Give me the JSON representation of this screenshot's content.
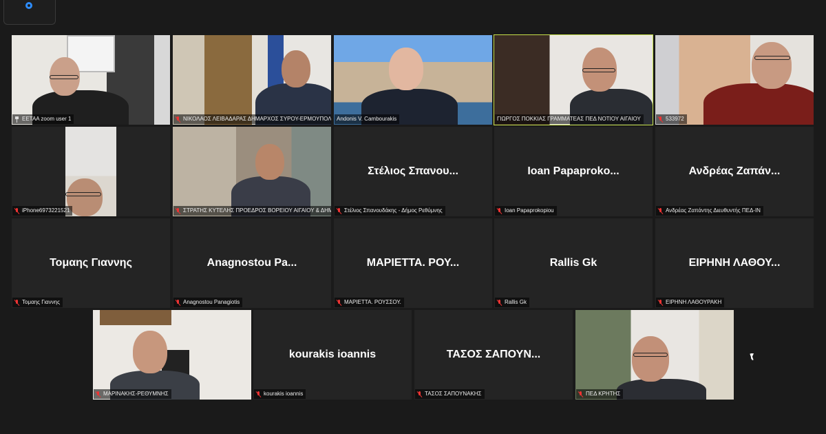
{
  "app": {
    "colors": {
      "background": "#1a1a1a",
      "tile": "#242424",
      "active_border": "#c7e24a",
      "muted_mic": "#e33333",
      "accent": "#2d8cff"
    }
  },
  "participants": [
    {
      "name": "ΕΕΤΑΑ zoom user 1",
      "video": true,
      "mic": "pin"
    },
    {
      "name": "ΝΙΚΟΛΑΟΣ ΛΕΙΒΑΔΑΡΑΣ ΔΗΜΑΡΧΟΣ ΣΥΡΟΥ-ΕΡΜΟΥΠΟΛ...",
      "video": true,
      "mic": "muted"
    },
    {
      "name": "Andonis V. Cambourakis",
      "video": true,
      "mic": "none"
    },
    {
      "name": "ΓΙΩΡΓΟΣ ΠΟΚΚΙΑΣ ΓΡΑΜΜΑΤΕΑΣ ΠΕΔ ΝΟΤΙΟΥ ΑΙΓΑΙΟΥ",
      "video": true,
      "mic": "none",
      "active": true
    },
    {
      "name": "533972",
      "video": true,
      "mic": "muted"
    },
    {
      "name": "iPhone6973221521",
      "video": true,
      "mic": "muted"
    },
    {
      "name": "ΣΤΡΑΤΗΣ ΚΥΤΕΛΗΣ ΠΡΟΕΔΡΟΣ ΒΟΡΕΙΟΥ ΑΙΓΑΙΟΥ & ΔΗΜ...",
      "video": true,
      "mic": "muted"
    },
    {
      "name": "Στέλιος Σπανουδάκης - Δήμος Ρεθύμνης",
      "display": "Στέλιος Σπανου...",
      "video": false,
      "mic": "muted"
    },
    {
      "name": "Ioan Papaprokopiou",
      "display": "Ioan  Papaproko...",
      "video": false,
      "mic": "muted"
    },
    {
      "name": "Ανδρέας Ζαπάντης Διευθυντής ΠΕΔ-ΙΝ",
      "display": "Ανδρέας Ζαπάν...",
      "video": false,
      "mic": "muted"
    },
    {
      "name": "Τομαης Γιαννης",
      "display": "Τομαης Γιαννης",
      "video": false,
      "mic": "muted"
    },
    {
      "name": "Anagnostou Panagiotis",
      "display": "Anagnostou  Pa...",
      "video": false,
      "mic": "muted"
    },
    {
      "name": "ΜΑΡΙΕΤΤΑ. ΡΟΥΣΣΟΥ.",
      "display": "ΜΑΡΙΕΤΤΑ.  ΡΟΥ...",
      "video": false,
      "mic": "muted"
    },
    {
      "name": "Rallis Gk",
      "display": "Rallis Gk",
      "video": false,
      "mic": "muted"
    },
    {
      "name": "ΕΙΡΗΝΗ ΛΑΘΟΥΡΑΚΗ",
      "display": "ΕΙΡΗΝΗ  ΛΑΘΟΥ...",
      "video": false,
      "mic": "muted"
    },
    {
      "name": "ΜΑΡΙΝΑΚΗΣ-ΡΕΘΥΜΝΗΣ",
      "video": true,
      "mic": "muted"
    },
    {
      "name": "kourakis ioannis",
      "display": "kourakis ioannis",
      "video": false,
      "mic": "muted"
    },
    {
      "name": "ΤΑΣΟΣ ΣΑΠΟΥΝΑΚΗΣ",
      "display": "ΤΑΣΟΣ  ΣΑΠΟΥΝ...",
      "video": false,
      "mic": "muted"
    },
    {
      "name": "ΠΕΔ ΚΡΗΤΗΣ",
      "video": true,
      "mic": "muted"
    }
  ]
}
